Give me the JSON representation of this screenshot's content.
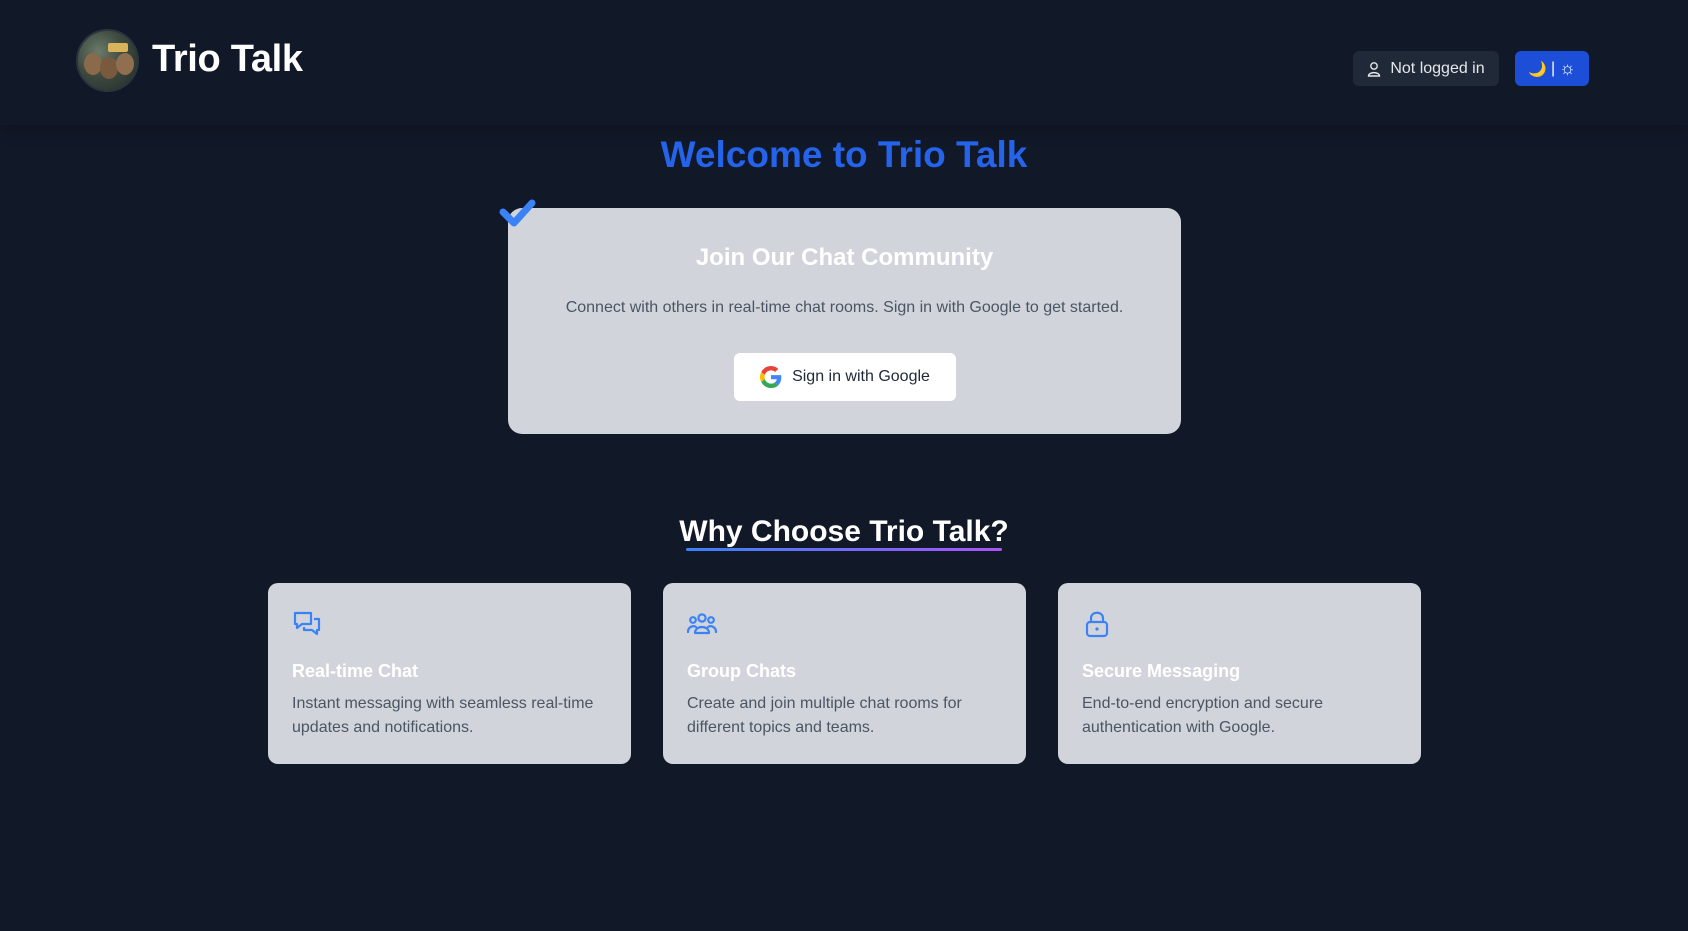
{
  "header": {
    "app_title": "Trio Talk",
    "logo_text": "TRIO TALK",
    "status_text": "Not logged in",
    "status_icon": "user-icon",
    "theme_toggle": {
      "moon": "🌙",
      "divider": "|",
      "sun": "☼"
    }
  },
  "hero": {
    "welcome_title": "Welcome to Trio Talk"
  },
  "signin_card": {
    "title": "Join Our Chat Community",
    "description": "Connect with others in real-time chat rooms. Sign in with Google to get started.",
    "button_label": "Sign in with Google",
    "button_icon": "google-icon"
  },
  "why": {
    "title": "Why Choose Trio Talk?"
  },
  "features": [
    {
      "icon": "chat-bubbles-icon",
      "title": "Real-time Chat",
      "description": "Instant messaging with seamless real-time updates and notifications."
    },
    {
      "icon": "users-group-icon",
      "title": "Group Chats",
      "description": "Create and join multiple chat rooms for different topics and teams."
    },
    {
      "icon": "lock-icon",
      "title": "Secure Messaging",
      "description": "End-to-end encryption and secure authentication with Google."
    }
  ],
  "colors": {
    "background": "#111827",
    "accent": "#2563eb",
    "card": "#d1d5db",
    "theme_button": "#1d4ed8",
    "gradient_start": "#3b82f6",
    "gradient_end": "#a855f7"
  }
}
